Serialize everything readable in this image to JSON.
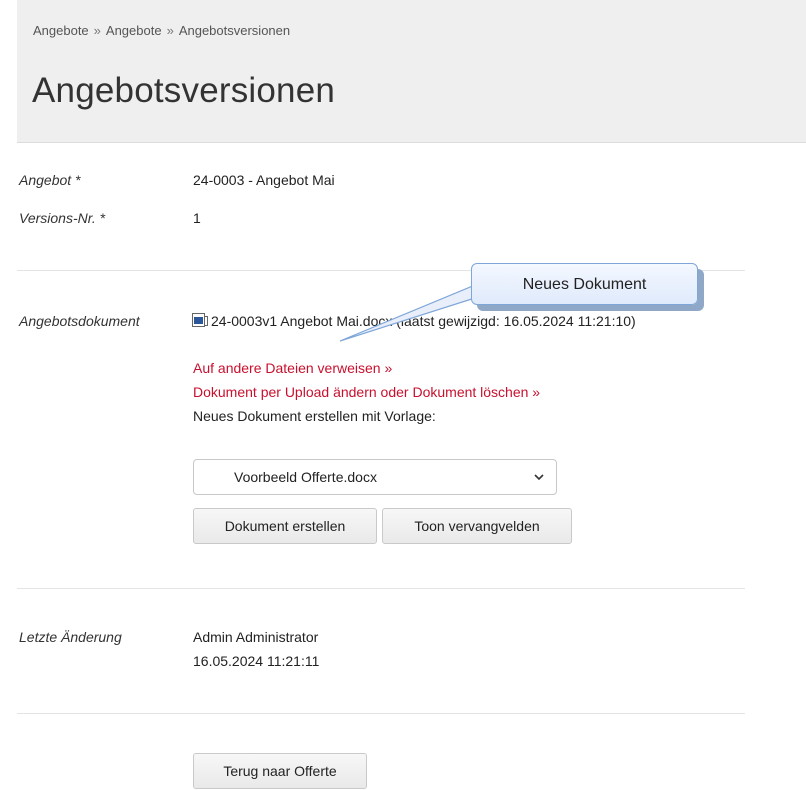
{
  "breadcrumb": {
    "items": [
      "Angebote",
      "Angebote",
      "Angebotsversionen"
    ],
    "separator": "»"
  },
  "page": {
    "title": "Angebotsversionen"
  },
  "form": {
    "angebot": {
      "label": "Angebot *",
      "value": "24-0003 - Angebot Mai"
    },
    "version": {
      "label": "Versions-Nr. *",
      "value": "1"
    },
    "document": {
      "label": "Angebotsdokument",
      "icon": "word-document-icon",
      "file_text": "24-0003v1 Angebot Mai.docx (laatst gewijzigd: 16.05.2024 11:21:10)",
      "link_refer": "Auf andere Dateien verweisen »",
      "link_upload": "Dokument per Upload ändern oder Dokument löschen »",
      "create_hint": "Neues Dokument erstellen mit Vorlage:",
      "template_select": {
        "selected": "Voorbeeld Offerte.docx"
      },
      "create_button": "Dokument erstellen",
      "fields_button": "Toon vervangvelden"
    },
    "last_change": {
      "label": "Letzte Änderung",
      "user": "Admin Administrator",
      "timestamp": "16.05.2024 11:21:11"
    },
    "back_button": "Terug naar Offerte"
  },
  "callout": {
    "text": "Neues Dokument"
  },
  "colors": {
    "link": "#c8102e",
    "header_bg": "#efefef",
    "callout_border": "#7ea6d8"
  }
}
